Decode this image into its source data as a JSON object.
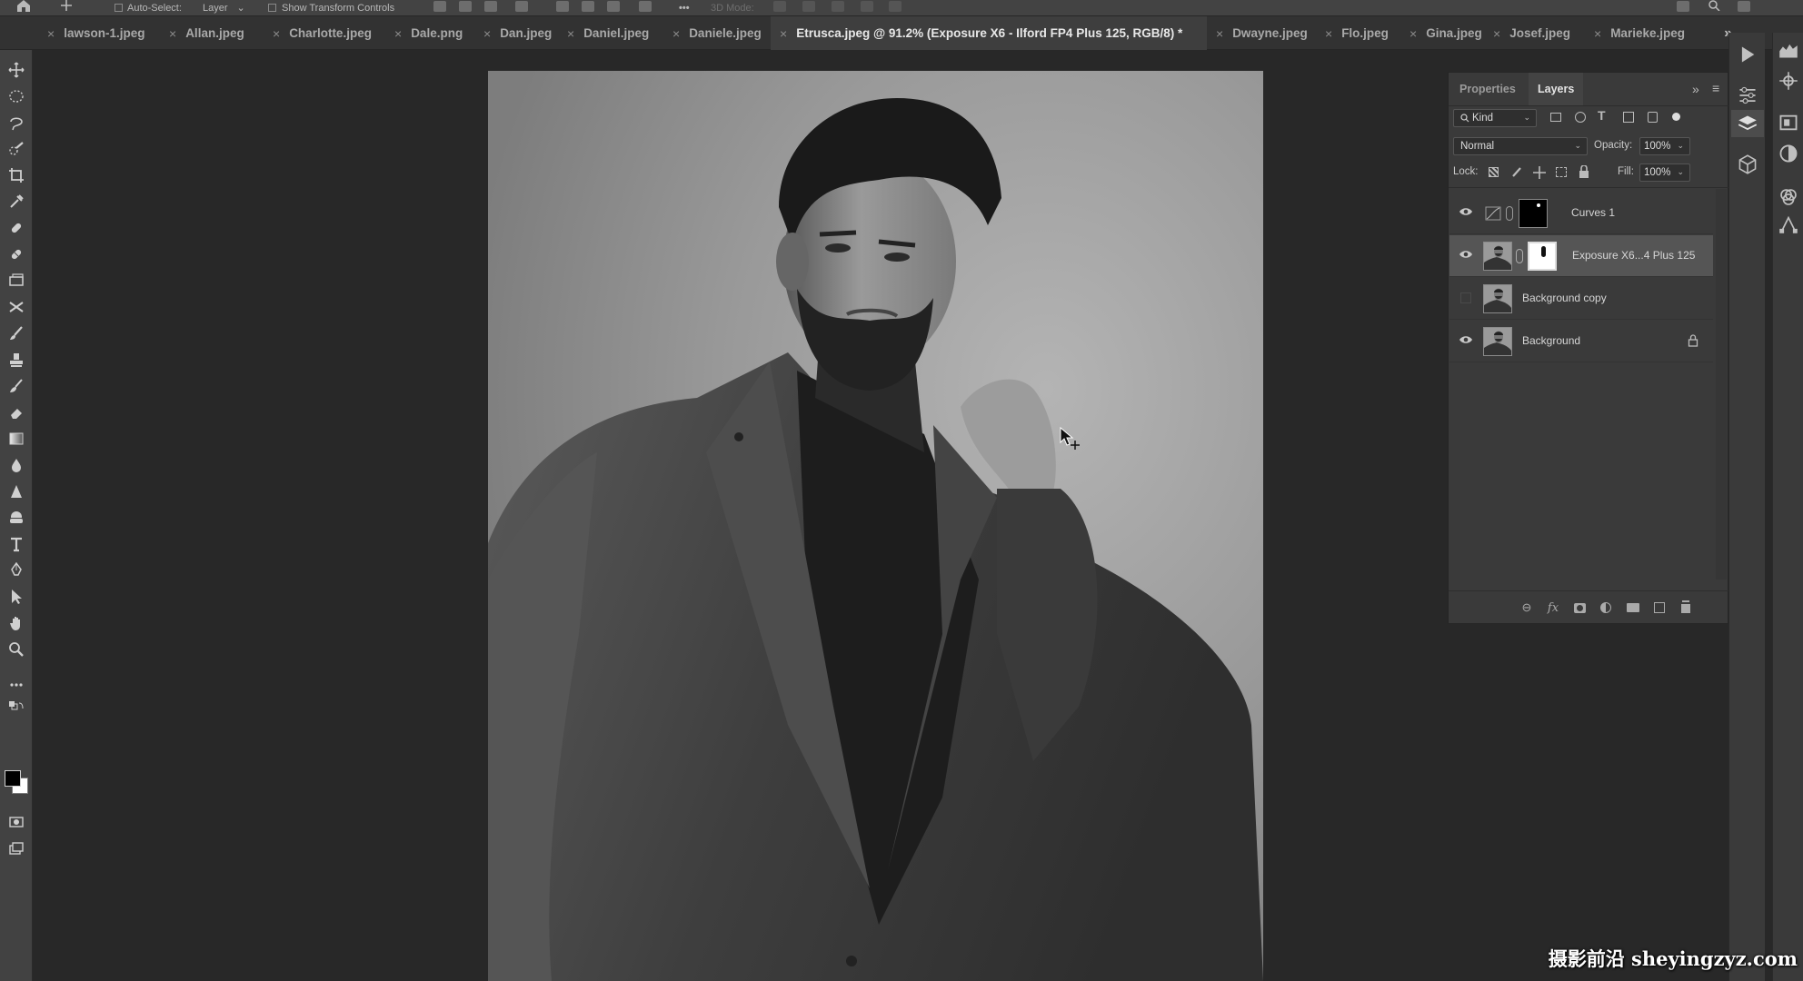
{
  "options_bar": {
    "auto_select_label": "Auto-Select:",
    "auto_select_value": "Layer",
    "show_transform_label": "Show Transform Controls",
    "mode_3d_label": "3D Mode:"
  },
  "tabs": [
    {
      "label": "lawson-1.jpeg",
      "active": false
    },
    {
      "label": "Allan.jpeg",
      "active": false
    },
    {
      "label": "Charlotte.jpeg",
      "active": false
    },
    {
      "label": "Dale.png",
      "active": false
    },
    {
      "label": "Dan.jpeg",
      "active": false
    },
    {
      "label": "Daniel.jpeg",
      "active": false
    },
    {
      "label": "Daniele.jpeg",
      "active": false
    },
    {
      "label": "Etrusca.jpeg @ 91.2% (Exposure X6 - Ilford FP4 Plus 125, RGB/8) *",
      "active": true
    },
    {
      "label": "Dwayne.jpeg",
      "active": false
    },
    {
      "label": "Flo.jpeg",
      "active": false
    },
    {
      "label": "Gina.jpeg",
      "active": false
    },
    {
      "label": "Josef.jpeg",
      "active": false
    },
    {
      "label": "Marieke.jpeg",
      "active": false
    }
  ],
  "tab_close_glyph": "×",
  "tab_overflow_glyph": "»",
  "tools": [
    "move-tool-icon",
    "elliptical-marquee-icon",
    "lasso-icon",
    "quick-selection-icon",
    "crop-icon",
    "eyedropper-icon",
    "spot-healing-icon",
    "healing-brush-icon",
    "patch-icon",
    "content-aware-move-icon",
    "brush-icon",
    "clone-stamp-icon",
    "history-brush-icon",
    "eraser-icon",
    "gradient-icon",
    "blur-icon",
    "sharpen-icon",
    "dodge-icon",
    "type-icon",
    "pen-icon",
    "path-selection-icon",
    "hand-icon",
    "zoom-icon",
    "more-tools-icon"
  ],
  "colors": {
    "foreground": "#000000",
    "background": "#ffffff",
    "panel": "#3a3a3a",
    "canvas_bg": "#282828",
    "selected_layer": "#555555"
  },
  "layers_panel": {
    "tab_properties": "Properties",
    "tab_layers": "Layers",
    "collapse_glyph": "»",
    "menu_glyph": "≡",
    "filter_kind": "Kind",
    "blend_mode": "Normal",
    "opacity_label": "Opacity:",
    "opacity_value": "100%",
    "lock_label": "Lock:",
    "fill_label": "Fill:",
    "fill_value": "100%",
    "layers": [
      {
        "name": "Curves 1",
        "visible": true,
        "selected": false,
        "type": "adjustment"
      },
      {
        "name": "Exposure X6...4 Plus 125",
        "visible": true,
        "selected": true,
        "type": "pixel-with-mask"
      },
      {
        "name": "Background copy",
        "visible": false,
        "selected": false,
        "type": "pixel"
      },
      {
        "name": "Background",
        "visible": true,
        "selected": false,
        "type": "locked",
        "locked": true
      }
    ],
    "footer_fx": "fx"
  },
  "document": {
    "subject": "black and white portrait photo"
  },
  "watermark": "摄影前沿 sheyingzyz.com"
}
